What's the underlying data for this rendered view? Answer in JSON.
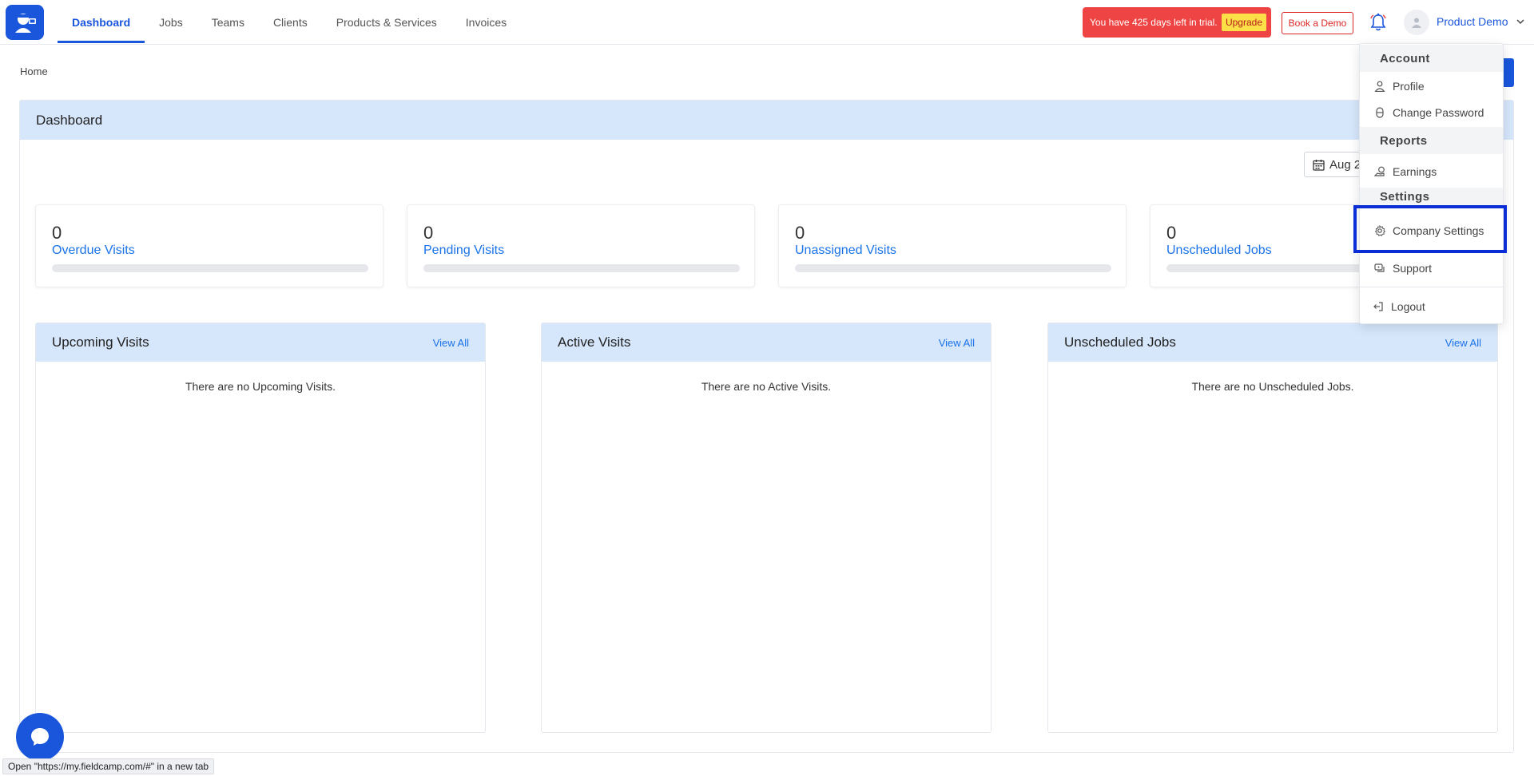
{
  "nav": {
    "items": [
      {
        "label": "Dashboard",
        "active": true
      },
      {
        "label": "Jobs",
        "active": false
      },
      {
        "label": "Teams",
        "active": false
      },
      {
        "label": "Clients",
        "active": false
      },
      {
        "label": "Products & Services",
        "active": false
      },
      {
        "label": "Invoices",
        "active": false
      }
    ]
  },
  "header": {
    "trial_text": "You have 425 days left in trial.",
    "upgrade_label": "Upgrade",
    "book_demo_label": "Book a Demo",
    "user_name": "Product Demo"
  },
  "breadcrumb": "Home",
  "dashboard": {
    "title": "Dashboard",
    "date_label": "Aug 2",
    "stats": [
      {
        "value": "0",
        "label": "Overdue Visits"
      },
      {
        "value": "0",
        "label": "Pending Visits"
      },
      {
        "value": "0",
        "label": "Unassigned Visits"
      },
      {
        "value": "0",
        "label": "Unscheduled Jobs"
      }
    ],
    "cards": [
      {
        "title": "Upcoming Visits",
        "link": "View All",
        "empty": "There are no Upcoming Visits."
      },
      {
        "title": "Active Visits",
        "link": "View All",
        "empty": "There are no Active Visits."
      },
      {
        "title": "Unscheduled Jobs",
        "link": "View All",
        "empty": "There are no Unscheduled Jobs."
      }
    ]
  },
  "menu": {
    "account_label": "Account",
    "profile": "Profile",
    "change_password": "Change Password",
    "reports_label": "Reports",
    "earnings": "Earnings",
    "settings_label": "Settings",
    "company_settings": "Company Settings",
    "support": "Support",
    "logout": "Logout"
  },
  "status_bar": "Open \"https://my.fieldcamp.com/#\" in a new tab",
  "colors": {
    "primary": "#1a56db",
    "link": "#1a73e8",
    "header_bg": "#d6e6fb",
    "trial_bg": "#ef4444",
    "upgrade_bg": "#fde047",
    "highlight": "#0b2dd6"
  }
}
